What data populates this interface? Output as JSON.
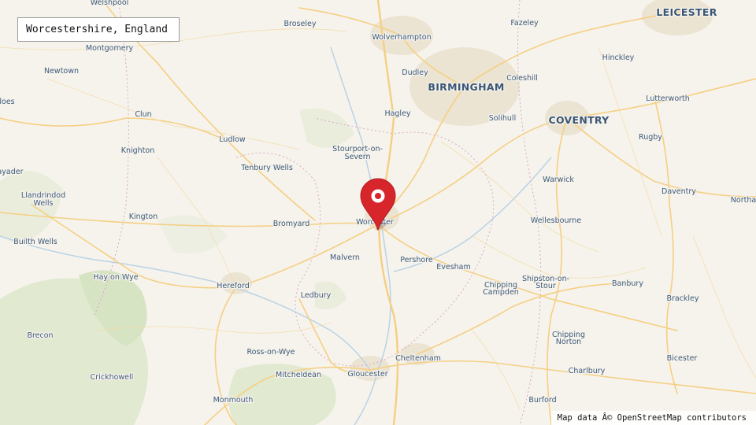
{
  "title": "Worcestershire, England",
  "attribution": "Map data Â© OpenStreetMap contributors",
  "colors": {
    "land": "#f6f3ec",
    "road": "#f5cf83",
    "marker": "#d7262b",
    "label": "#3d5a7a",
    "woodland": "#dfe9cf",
    "urban": "#efe7d6"
  },
  "marker": {
    "icon": "map-pin-icon",
    "place": "Worcester"
  },
  "places": {
    "welshpool": "Welshpool",
    "montgomery": "Montgomery",
    "newtown": "Newtown",
    "broseley": "Broseley",
    "wolverhampton": "Wolverhampton",
    "fazeley": "Fazeley",
    "leicester": "LEICESTER",
    "dudley": "Dudley",
    "birmingham": "BIRMINGHAM",
    "coleshill": "Coleshill",
    "hinckley": "Hinckley",
    "lutterworth": "Lutterworth",
    "coventry": "COVENTRY",
    "solihull": "Solihull",
    "hagley": "Hagley",
    "rugby": "Rugby",
    "clun": "Clun",
    "ludlow": "Ludlow",
    "knighton": "Knighton",
    "stourport": "Stourport-on-",
    "stourport2": "Severn",
    "tenbury": "Tenbury Wells",
    "warwick": "Warwick",
    "daventry": "Daventry",
    "rhayader": "ayader",
    "llandrindod": "Llandrindod",
    "llandrindod2": "Wells",
    "kington": "Kington",
    "bromyard": "Bromyard",
    "worcester": "Worcester",
    "wellesbourne": "Wellesbourne",
    "northampton": "Northa",
    "builth": "Builth Wells",
    "malvern": "Malvern",
    "pershore": "Pershore",
    "evesham": "Evesham",
    "hayonwye": "Hay on Wye",
    "hereford": "Hereford",
    "chipping_campden": "Chipping",
    "chipping_campden2": "Campden",
    "shipston": "Shipston-on-",
    "shipston2": "Stour",
    "banbury": "Banbury",
    "ledbury": "Ledbury",
    "brackley": "Brackley",
    "brecon": "Brecon",
    "ross": "Ross-on-Wye",
    "chipping_norton": "Chipping",
    "chipping_norton2": "Norton",
    "cheltenham": "Cheltenham",
    "bicester": "Bicester",
    "crickhowell": "Crickhowell",
    "mitcheldean": "Mitcheldean",
    "gloucester": "Gloucester",
    "charlbury": "Charlbury",
    "monmouth": "Monmouth",
    "burford": "Burford",
    "rhos": "loes"
  }
}
